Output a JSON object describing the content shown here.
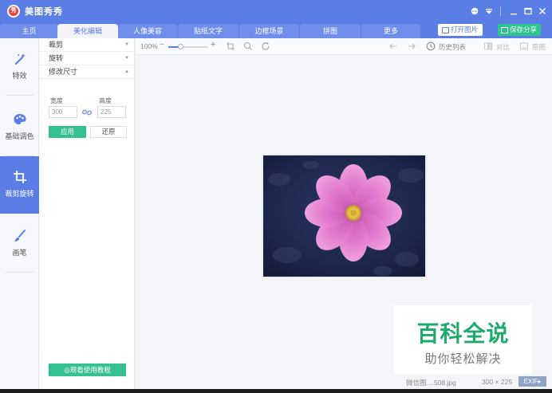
{
  "app": {
    "title": "美图秀秀",
    "logo_text": "秀"
  },
  "tabs": [
    {
      "label": "主页"
    },
    {
      "label": "美化编辑"
    },
    {
      "label": "人像美容"
    },
    {
      "label": "贴纸文字"
    },
    {
      "label": "边框场景"
    },
    {
      "label": "拼图"
    },
    {
      "label": "更多"
    }
  ],
  "header_actions": {
    "open_label": "打开图片",
    "save_label": "保存分享"
  },
  "left_rail": [
    {
      "label": "特效",
      "icon": "magic-wand-icon"
    },
    {
      "label": "基础调色",
      "icon": "palette-icon"
    },
    {
      "label": "裁剪旋转",
      "icon": "crop-icon",
      "active": true
    },
    {
      "label": "画笔",
      "icon": "brush-icon"
    }
  ],
  "tool_panel": {
    "sections": [
      {
        "label": "裁剪"
      },
      {
        "label": "旋转"
      },
      {
        "label": "修改尺寸"
      }
    ],
    "width_label": "宽度",
    "height_label": "高度",
    "width_value": "300",
    "height_value": "225",
    "apply_label": "应用",
    "reset_label": "还原",
    "tutorial_label": "◎观看使用教程"
  },
  "canvas_toolbar": {
    "zoom_label": "100%",
    "zoom_level": 0.3,
    "history_label": "历史列表",
    "compare_label": "对比",
    "original_label": "原图"
  },
  "status": {
    "file_name": "微信图....508.jpg",
    "dimensions": "300 × 225",
    "exif_label": "EXIF"
  },
  "watermark": {
    "title": "百科全说",
    "subtitle": "助你轻松解决"
  },
  "colors": {
    "brand": "#5a7de6",
    "accent_green": "#35c08f",
    "save_green": "#2bc48d"
  }
}
